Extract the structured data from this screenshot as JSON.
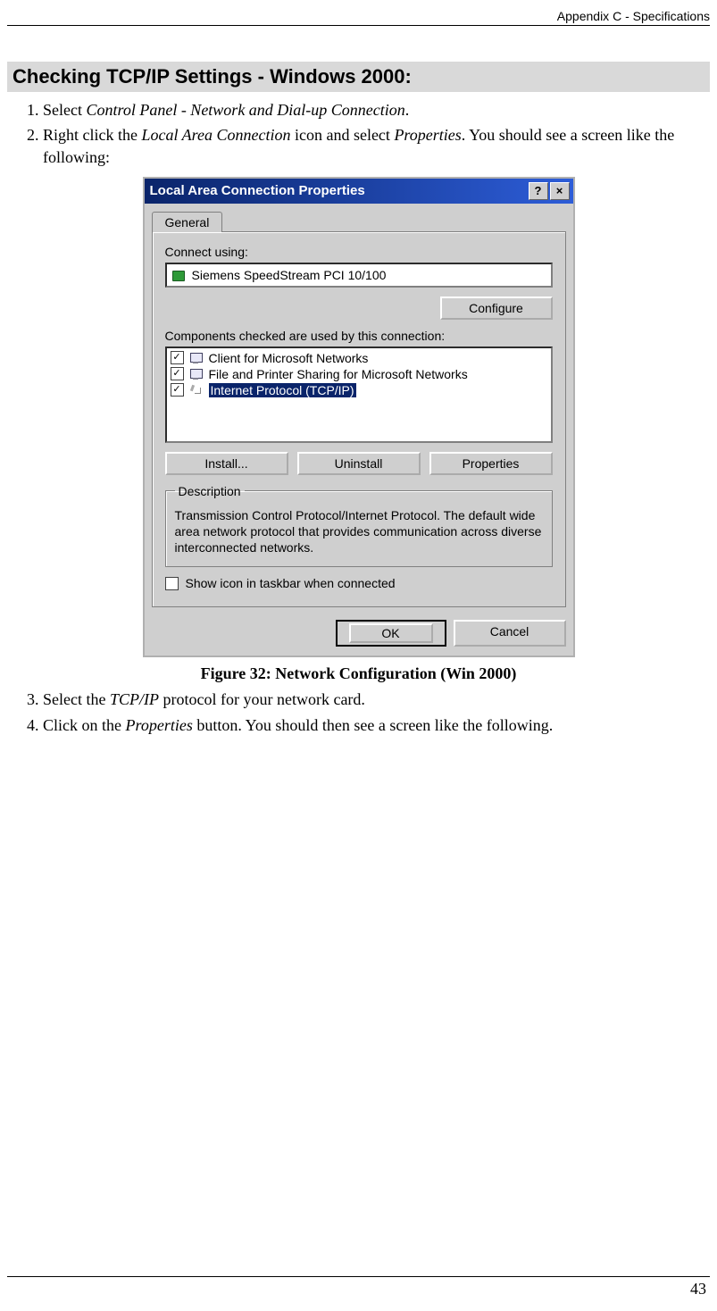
{
  "header": {
    "right": "Appendix C - Specifications"
  },
  "heading": "Checking TCP/IP Settings - Windows 2000:",
  "steps": {
    "s1_a": "Select ",
    "s1_i": "Control Panel - Network and Dial-up Connection",
    "s1_b": ".",
    "s2_a": "Right click the ",
    "s2_i1": "Local Area Connection",
    "s2_b": " icon and select ",
    "s2_i2": "Properties",
    "s2_c": ". You should see a screen like the following:",
    "s3_a": "Select the ",
    "s3_i": "TCP/IP",
    "s3_b": " protocol for your network card.",
    "s4_a": "Click on the ",
    "s4_i": "Properties",
    "s4_b": " button. You should then see a screen like the following."
  },
  "dialog": {
    "title": "Local Area Connection Properties",
    "help": "?",
    "close": "×",
    "tab": "General",
    "connect_label": "Connect using:",
    "adapter": "Siemens SpeedStream PCI 10/100",
    "configure": "Configure",
    "components_label": "Components checked are used by this connection:",
    "items": [
      "Client for Microsoft Networks",
      "File and Printer Sharing for Microsoft Networks",
      "Internet Protocol (TCP/IP)"
    ],
    "check": "✓",
    "install": "Install...",
    "uninstall": "Uninstall",
    "properties": "Properties",
    "description_label": "Description",
    "description_text": "Transmission Control Protocol/Internet Protocol. The default wide area network protocol that provides communication across diverse interconnected networks.",
    "show_icon": "Show icon in taskbar when connected",
    "ok": "OK",
    "cancel": "Cancel"
  },
  "figure_caption": "Figure 32: Network Configuration (Win 2000)",
  "page_number": "43"
}
